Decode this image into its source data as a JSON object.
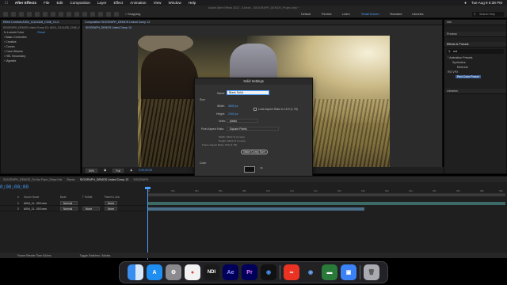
{
  "menubar": {
    "apple": "",
    "app": "After Effects",
    "items": [
      "File",
      "Edit",
      "Composition",
      "Layer",
      "Effect",
      "Animation",
      "View",
      "Window",
      "Help"
    ],
    "clock": "Tue Aug 9  5:38 PM"
  },
  "window_title": "Adobe After Effects 2022 - /Users/.../SIGGRAPH_DEMOS_Project.aep *",
  "toolbar": {
    "snapping": "Snapping",
    "workspaces": [
      "Default",
      "Review",
      "Learn",
      "Small Screen",
      "Standard",
      "Libraries"
    ],
    "active_workspace": "Small Screen",
    "search_help": "Search Help"
  },
  "effect_controls": {
    "tab": "Effect Controls A004_11141428_C046_V1-0",
    "layer_path": "SIGGRAPH_DEMOS Linked Comp 13 • A004_11141428_C046_V1",
    "items": [
      "fx Lumetri Color",
      "Reset",
      "Basic Correction",
      "Creative",
      "Curves",
      "Color Wheels",
      "HSL Secondary",
      "Vignette"
    ]
  },
  "composition": {
    "tab": "Composition SIGGRAPH_DEMOS Linked Comp 13",
    "breadcrumb": "SIGGRAPH_DEMOS Linked Comp 13",
    "zoom": "50%",
    "resolution": "Full",
    "timecode": "0;00;00;00"
  },
  "dialog": {
    "title": "Solid Settings",
    "name_label": "Name:",
    "name_value": "Black Solid",
    "size_section": "Size",
    "width_label": "Width:",
    "width_value": "3840 px",
    "lock_label": "Lock Aspect Ratio to 16:9 (1.78)",
    "height_label": "Height:",
    "height_value": "2160 px",
    "units_label": "Units:",
    "units_value": "pixels",
    "par_label": "Pixel Aspect Ratio:",
    "par_value": "Square Pixels",
    "info_width": "Width: 100.0 % of comp",
    "info_height": "Height: 100.0 % of comp",
    "info_frame": "Frame Aspect Ratio: 16:9 (1.78)",
    "make_comp_size": "Make Comp Size",
    "color_section": "Color",
    "preview_label": "Preview",
    "cancel": "Cancel",
    "ok": "OK"
  },
  "right_panel": {
    "info": "Info",
    "preview": "Preview",
    "effects_presets": "Effects & Presets",
    "search_value": "red",
    "tree": [
      "* Animation Presets",
      "Synthetics",
      "Ethereal",
      "RG VFX",
      "Red Color Preset"
    ],
    "libraries": "Libraries"
  },
  "timeline": {
    "tabs": [
      "SIGGRAPH_DEMOS_On the Farm_Straw Hat",
      "Starter",
      "SIGGRAPH_DEMOS Linked Comp 13",
      "SIGGRAPH"
    ],
    "active_tab": "SIGGRAPH_DEMOS Linked Comp 13",
    "timecode": "0;00;00;00",
    "columns": [
      "#",
      "Source Name",
      "Mode",
      "T TrkMat",
      "Parent & Link"
    ],
    "layers": [
      {
        "index": "1",
        "name": "A004_11...003.mov",
        "mode": "Normal",
        "trkmat": "",
        "parent": "None"
      },
      {
        "index": "2",
        "name": "A004_11...003.mov",
        "mode": "Normal",
        "trkmat": "None",
        "parent": "None"
      }
    ],
    "ruler": [
      "0s",
      "02s",
      "04s",
      "06s",
      "08s",
      "10s",
      "12s",
      "14s",
      "16s",
      "18s",
      "20s",
      "22s",
      "24s",
      "26s",
      "28s",
      "30s"
    ],
    "footer_render": "Frame Render Time  544ms",
    "footer_toggle": "Toggle Switches / Modes"
  },
  "dock": {
    "apps": [
      "Finder",
      "App Store",
      "Settings",
      "Chrome",
      "NDI",
      "After Effects",
      "Premiere Pro",
      "Cinema 4D",
      "Creative Cloud",
      "Cinema 4D Lite",
      "Monitor",
      "Preview",
      "Trash"
    ]
  }
}
